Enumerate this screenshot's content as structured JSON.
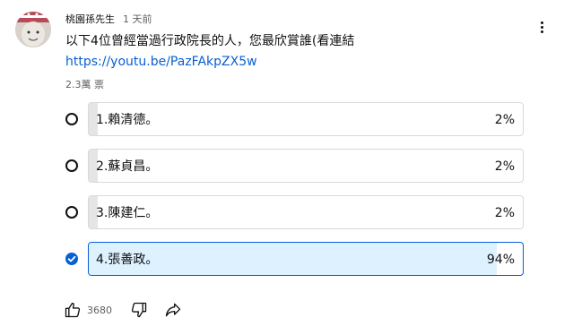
{
  "post": {
    "author": "桃園孫先生",
    "time": "1 天前",
    "text": "以下4位曾經當過行政院長的人，您最欣賞誰(看連結",
    "link": "https://youtu.be/PazFAkpZX5w",
    "votes": "2.3萬 票"
  },
  "poll": {
    "options": [
      {
        "label": "1.賴清德。",
        "percent": "2%",
        "fill": 0.02,
        "selected": false
      },
      {
        "label": "2.蘇貞昌。",
        "percent": "2%",
        "fill": 0.02,
        "selected": false
      },
      {
        "label": "3.陳建仁。",
        "percent": "2%",
        "fill": 0.02,
        "selected": false
      },
      {
        "label": "4.張善政。",
        "percent": "94%",
        "fill": 0.94,
        "selected": true
      }
    ]
  },
  "actions": {
    "like_count": "3680",
    "icons": [
      "thumb-up-icon",
      "thumb-down-icon",
      "share-icon",
      "more-vert-icon"
    ]
  },
  "colors": {
    "accent": "#065fd4",
    "selected_fill": "#def1ff",
    "bar_fill": "#e5e5e5",
    "secondary_text": "#606060"
  }
}
